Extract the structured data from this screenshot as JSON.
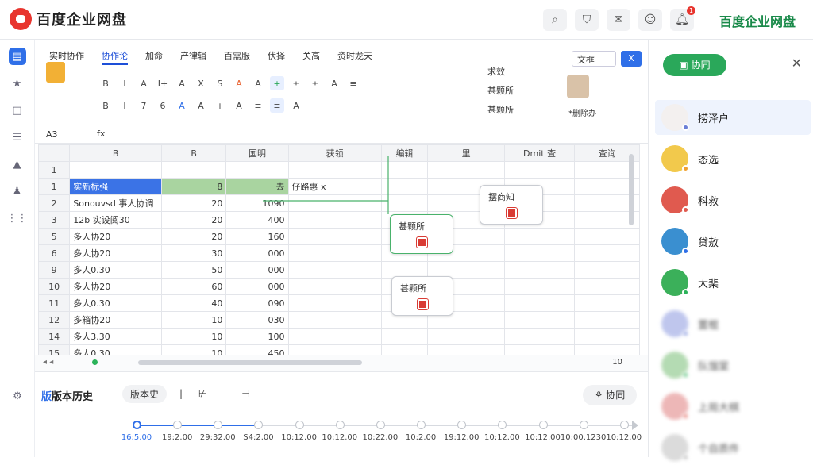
{
  "app": {
    "brand": "百度企业网盘",
    "brand_right": "百度企业网盘",
    "notification_count": "1"
  },
  "leftnav": {
    "items": [
      "doc-icon",
      "star-icon",
      "chart-icon",
      "list-icon",
      "tree-icon",
      "person-icon",
      "grid-icon"
    ],
    "settings": "gear-icon"
  },
  "ribbon": {
    "tabs": [
      "实时协作",
      "协作论",
      "加命",
      "产律辑",
      "百需服",
      "伏择",
      "关高",
      "资时龙天"
    ],
    "active_tab": "协作论",
    "font_select": "文框",
    "close_label": "X",
    "right_group": [
      "求效",
      "甚颗所",
      "甚颗所"
    ],
    "row1": [
      "B",
      "I",
      "A",
      "I+",
      "A",
      "X",
      "S",
      "A",
      "A",
      "+",
      "±",
      "±",
      "A",
      "≡"
    ],
    "row2": [
      "B",
      "I",
      "7",
      "6",
      "A",
      "A",
      "+",
      "A",
      "≡",
      "≡",
      "A"
    ],
    "bottom_label": "*删除办"
  },
  "formula": {
    "cell_ref": "A3",
    "fx": "fx"
  },
  "sheet": {
    "col_headers": [
      "",
      "B",
      "B",
      "国明",
      "获领",
      "编辑",
      "里",
      "Dmit 查",
      "查询"
    ],
    "rows": [
      {
        "n": "1",
        "b": "",
        "c": "",
        "d": "",
        "e": "",
        "f": ""
      },
      {
        "n": "1",
        "b": "实新标强",
        "c": "8",
        "d": "去",
        "e": "仔路惠 x",
        "f": ""
      },
      {
        "n": "2",
        "b": "Sonouvsd 事人协调",
        "c": "20",
        "d": "1090",
        "e": "",
        "f": ""
      },
      {
        "n": "3",
        "b": "12b 实设阅30",
        "c": "20",
        "d": "400",
        "e": "",
        "f": ""
      },
      {
        "n": "5",
        "b": "多人协20",
        "c": "20",
        "d": "160",
        "e": "",
        "f": ""
      },
      {
        "n": "6",
        "b": "多人协20",
        "c": "30",
        "d": "000",
        "e": "",
        "f": ""
      },
      {
        "n": "9",
        "b": "多人0.30",
        "c": "50",
        "d": "000",
        "e": "",
        "f": ""
      },
      {
        "n": "10",
        "b": "多人协20",
        "c": "60",
        "d": "000",
        "e": "",
        "f": ""
      },
      {
        "n": "11",
        "b": "多人0.30",
        "c": "40",
        "d": "090",
        "e": "",
        "f": ""
      },
      {
        "n": "12",
        "b": "多箱协20",
        "c": "10",
        "d": "030",
        "e": "",
        "f": ""
      },
      {
        "n": "14",
        "b": "多人3.30",
        "c": "10",
        "d": "100",
        "e": "",
        "f": ""
      },
      {
        "n": "15",
        "b": "多人0.30",
        "c": "10",
        "d": "450",
        "e": "",
        "f": ""
      }
    ],
    "cards": [
      {
        "label": "甚颗所"
      },
      {
        "label": "甚颗所"
      },
      {
        "label": "摆商知"
      }
    ],
    "sheet_count": "10"
  },
  "version_history": {
    "title": "版本历史",
    "title_prefix": "版",
    "chip": "版本史",
    "controls": "| ⊬ - ⊣",
    "collab_button": "协同",
    "timeline": [
      "16:5.00",
      "19:2.00",
      "29:32.00",
      "S4:2.00",
      "10:12.00",
      "10:12.00",
      "10:22.00",
      "10:2.00",
      "19:12.00",
      "10:12.00",
      "10:12.00",
      "10:00.1230",
      "10:12.00"
    ],
    "progress": 0.24
  },
  "right_panel": {
    "collab_label": "协同",
    "people": [
      {
        "name": "捞泽户",
        "color": "#f3f0ef",
        "status": "#6b7fd6",
        "selected": true
      },
      {
        "name": "态选",
        "color": "#f2c94c",
        "status": "#f0a030"
      },
      {
        "name": "科救",
        "color": "#e05a4f",
        "status": "#e05a4f"
      },
      {
        "name": "贷敖",
        "color": "#3a8fd0",
        "status": "#2f6fe8"
      },
      {
        "name": "大棐",
        "color": "#3bb05a",
        "status": "#2bb35a"
      },
      {
        "name": "置棍",
        "color": "#aab4e8",
        "status": "#6b7fd6",
        "blur": true
      },
      {
        "name": "队馏棠",
        "color": "#9ccf9a",
        "status": "#2bb35a",
        "blur": true
      },
      {
        "name": "上局大棋",
        "color": "#e8a0a0",
        "status": "#e05a4f",
        "blur": true
      },
      {
        "name": "个自质件",
        "color": "#cfcfcf",
        "status": "#aaa",
        "blur": true
      }
    ]
  }
}
